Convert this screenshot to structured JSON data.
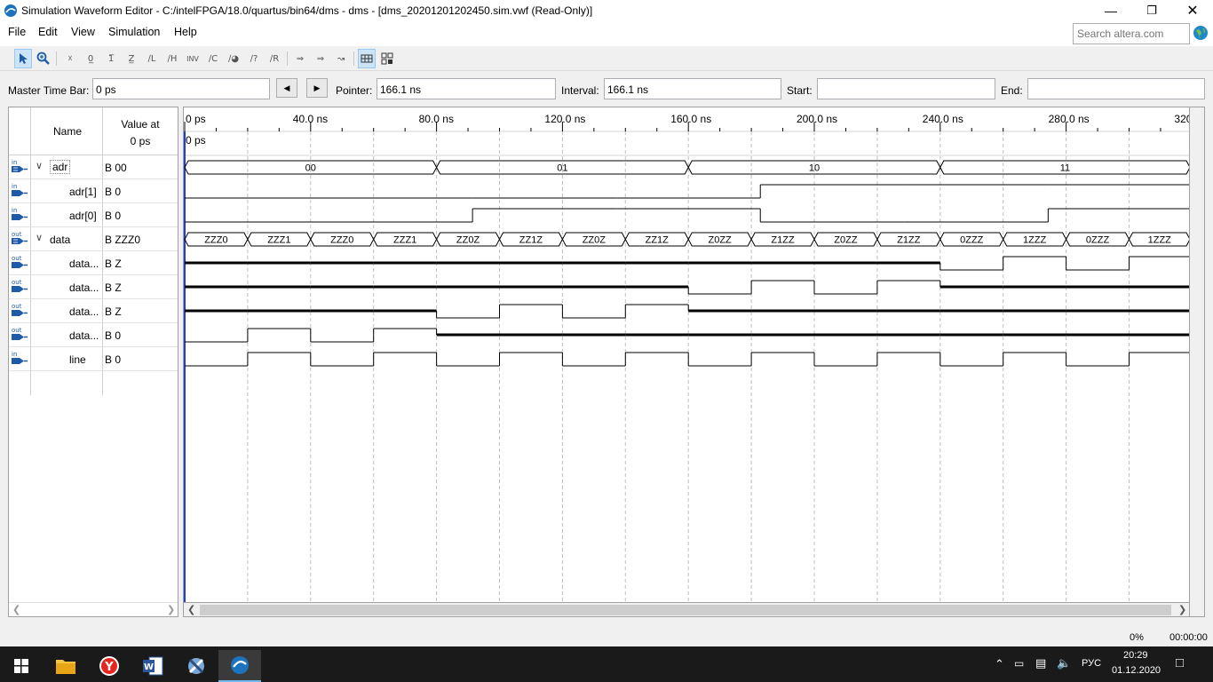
{
  "window": {
    "title": "Simulation Waveform Editor - C:/intelFPGA/18.0/quartus/bin64/dms - dms - [dms_20201201202450.sim.vwf (Read-Only)]"
  },
  "menu": {
    "items": [
      "File",
      "Edit",
      "View",
      "Simulation",
      "Help"
    ]
  },
  "search": {
    "placeholder": "Search altera.com"
  },
  "toolbar": {
    "tools": [
      "pointer",
      "zoom",
      "unknown",
      "force-low",
      "force-high",
      "high-impedance",
      "weak-low",
      "weak-high",
      "invert",
      "count",
      "overwrite-clock",
      "random",
      "arbitrary",
      "snap-to-grid",
      "select-bus"
    ]
  },
  "timebar": {
    "master_label": "Master Time Bar:",
    "master_value": "0 ps",
    "pointer_label": "Pointer:",
    "pointer_value": "166.1 ns",
    "interval_label": "Interval:",
    "interval_value": "166.1 ns",
    "start_label": "Start:",
    "start_value": "",
    "end_label": "End:",
    "end_value": ""
  },
  "table": {
    "name_header": "Name",
    "value_header_line1": "Value at",
    "value_header_line2": "0 ps",
    "signals": [
      {
        "dir": "in",
        "name": "adr",
        "value": "B 00",
        "group": true
      },
      {
        "dir": "in",
        "name": "adr[1]",
        "value": "B 0",
        "group": false
      },
      {
        "dir": "in",
        "name": "adr[0]",
        "value": "B 0",
        "group": false
      },
      {
        "dir": "out",
        "name": "data",
        "value": "B ZZZ0",
        "group": true
      },
      {
        "dir": "out",
        "name": "data...",
        "value": "B Z",
        "group": false
      },
      {
        "dir": "out",
        "name": "data...",
        "value": "B Z",
        "group": false
      },
      {
        "dir": "out",
        "name": "data...",
        "value": "B Z",
        "group": false
      },
      {
        "dir": "out",
        "name": "data...",
        "value": "B 0",
        "group": false
      },
      {
        "dir": "in",
        "name": "line",
        "value": "B 0",
        "group": false
      }
    ]
  },
  "waveform": {
    "time_labels": [
      "0 ps",
      "40.0 ns",
      "80.0 ns",
      "120.0 ns",
      "160.0 ns",
      "200.0 ns",
      "240.0 ns",
      "280.0 ns",
      "320.0 ns"
    ],
    "marker_label": "0 ps",
    "adr_bus": [
      "00",
      "01",
      "10",
      "11"
    ],
    "data_bus": [
      "ZZZ0",
      "ZZZ1",
      "ZZZ0",
      "ZZZ1",
      "ZZ0Z",
      "ZZ1Z",
      "ZZ0Z",
      "ZZ1Z",
      "Z0ZZ",
      "Z1ZZ",
      "Z0ZZ",
      "Z1ZZ",
      "0ZZZ",
      "1ZZZ",
      "0ZZZ",
      "1ZZZ"
    ],
    "adr1": "0000111",
    "adr0": "0011001",
    "data3": "ZZZZZZZZZZZZ0101",
    "data2": "ZZZZZZZZ0101ZZZZ",
    "data1": "ZZZZ0101ZZZZZZZZ",
    "data0": "0101ZZZZZZZZZZZZ",
    "line": "0101010101010101"
  },
  "status": {
    "progress": "0%",
    "elapsed": "00:00:00"
  },
  "taskbar": {
    "lang": "РУС",
    "time": "20:29",
    "date": "01.12.2020"
  }
}
